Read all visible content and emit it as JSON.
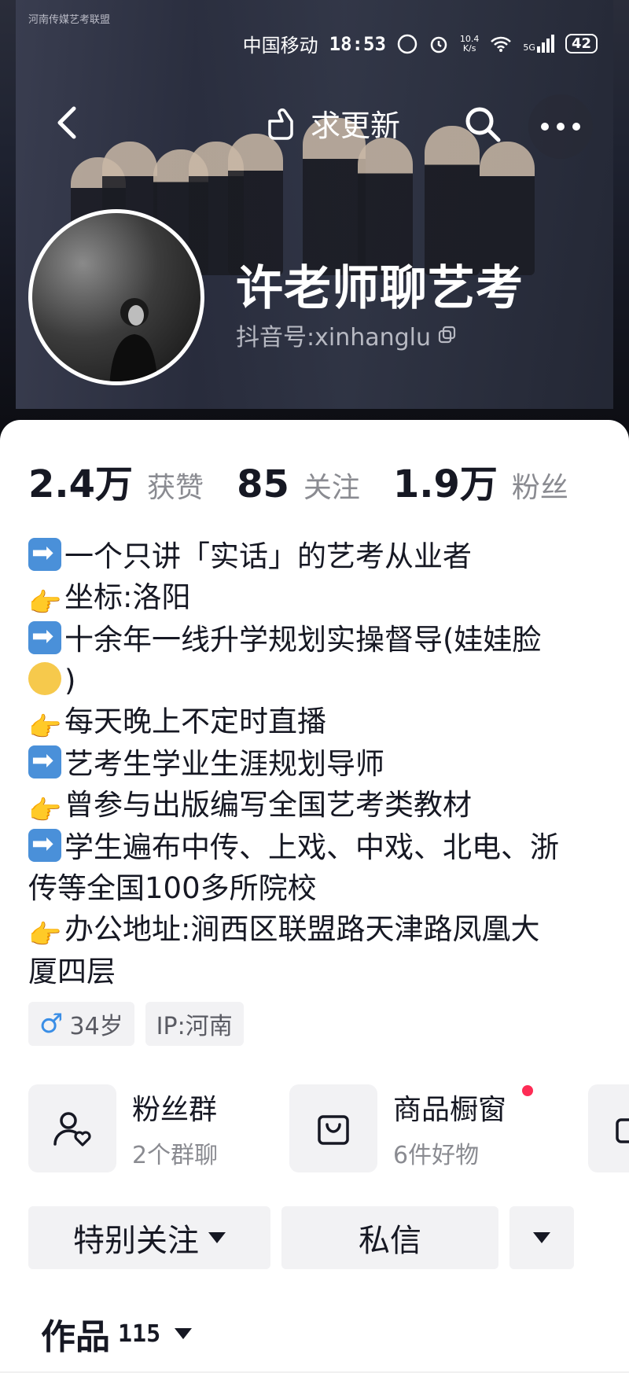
{
  "status_bar": {
    "carrier": "中国移动",
    "time": "18:53",
    "net_speed_top": "10.4",
    "net_speed_bottom": "K/s",
    "signal_label": "5G",
    "battery": "42"
  },
  "header": {
    "update_label": "求更新",
    "brand_text": "河南传媒艺考联盟"
  },
  "profile": {
    "name": "许老师聊艺考",
    "handle": "抖音号:xinhanglu"
  },
  "stats": [
    {
      "value": "2.4万",
      "label": "获赞"
    },
    {
      "value": "85",
      "label": "关注"
    },
    {
      "value": "1.9万",
      "label": "粉丝"
    }
  ],
  "bio": [
    {
      "icon": "arrow",
      "text": "一个只讲「实话」的艺考从业者"
    },
    {
      "icon": "point",
      "text": "坐标:洛阳"
    },
    {
      "icon": "arrow",
      "text": "十余年一线升学规划实操督导(娃娃脸"
    },
    {
      "icon": "cry",
      "text": ")"
    },
    {
      "icon": "point",
      "text": "每天晚上不定时直播"
    },
    {
      "icon": "arrow",
      "text": "艺考生学业生涯规划导师"
    },
    {
      "icon": "point",
      "text": "曾参与出版编写全国艺考类教材"
    },
    {
      "icon": "arrow",
      "text": "学生遍布中传、上戏、中戏、北电、浙"
    },
    {
      "icon": "",
      "text": "传等全国100多所院校"
    },
    {
      "icon": "point",
      "text": "办公地址:涧西区联盟路天津路凤凰大"
    },
    {
      "icon": "",
      "text": "厦四层"
    }
  ],
  "tags": {
    "gender_symbol": "♂",
    "age": "34岁",
    "ip": "IP:河南"
  },
  "features": [
    {
      "title": "粉丝群",
      "subtitle": "2个群聊"
    },
    {
      "title": "商品橱窗",
      "subtitle": "6件好物"
    }
  ],
  "actions": {
    "follow_label": "特别关注",
    "message_label": "私信"
  },
  "works": {
    "label": "作品",
    "count": "115"
  },
  "colors": {
    "accent_red": "#fe2c55",
    "text": "#161823",
    "muted": "#8a8b91",
    "chip_bg": "#f2f2f4"
  }
}
